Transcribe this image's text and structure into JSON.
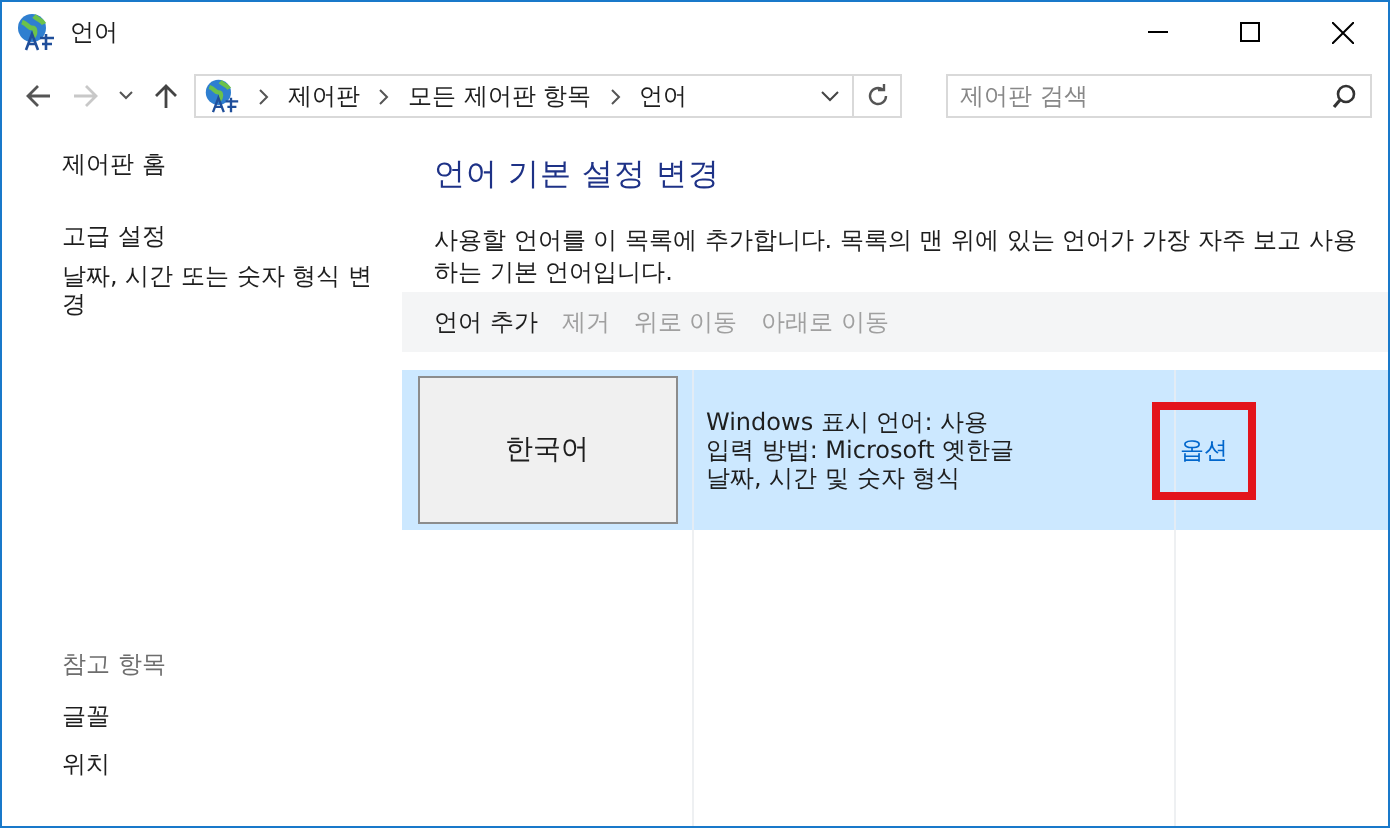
{
  "window": {
    "title": "언어"
  },
  "nav": {
    "back": {
      "disabled": false
    },
    "forward": {
      "disabled": true
    },
    "breadcrumb": [
      "제어판",
      "모든 제어판 항목",
      "언어"
    ],
    "search": {
      "placeholder": "제어판 검색"
    }
  },
  "sidebar": {
    "links": [
      "제어판 홈",
      "고급 설정",
      "날짜, 시간 또는 숫자 형식 변경"
    ],
    "see_also": {
      "heading": "참고 항목",
      "links": [
        "글꼴",
        "위치"
      ]
    }
  },
  "main": {
    "heading": "언어 기본 설정 변경",
    "description": "사용할 언어를 이 목록에 추가합니다. 목록의 맨 위에 있는 언어가 가장 자주 보고 사용하는 기본 언어입니다.",
    "toolbar": [
      {
        "label": "언어 추가",
        "disabled": false
      },
      {
        "label": "제거",
        "disabled": true
      },
      {
        "label": "위로 이동",
        "disabled": true
      },
      {
        "label": "아래로 이동",
        "disabled": true
      }
    ],
    "languages": [
      {
        "name": "한국어",
        "selected": true,
        "details": [
          "Windows 표시 언어: 사용",
          "입력 방법: Microsoft 옛한글",
          "날짜, 시간 및 숫자 형식"
        ],
        "options": {
          "label": "옵션",
          "highlighted": true
        }
      }
    ]
  }
}
